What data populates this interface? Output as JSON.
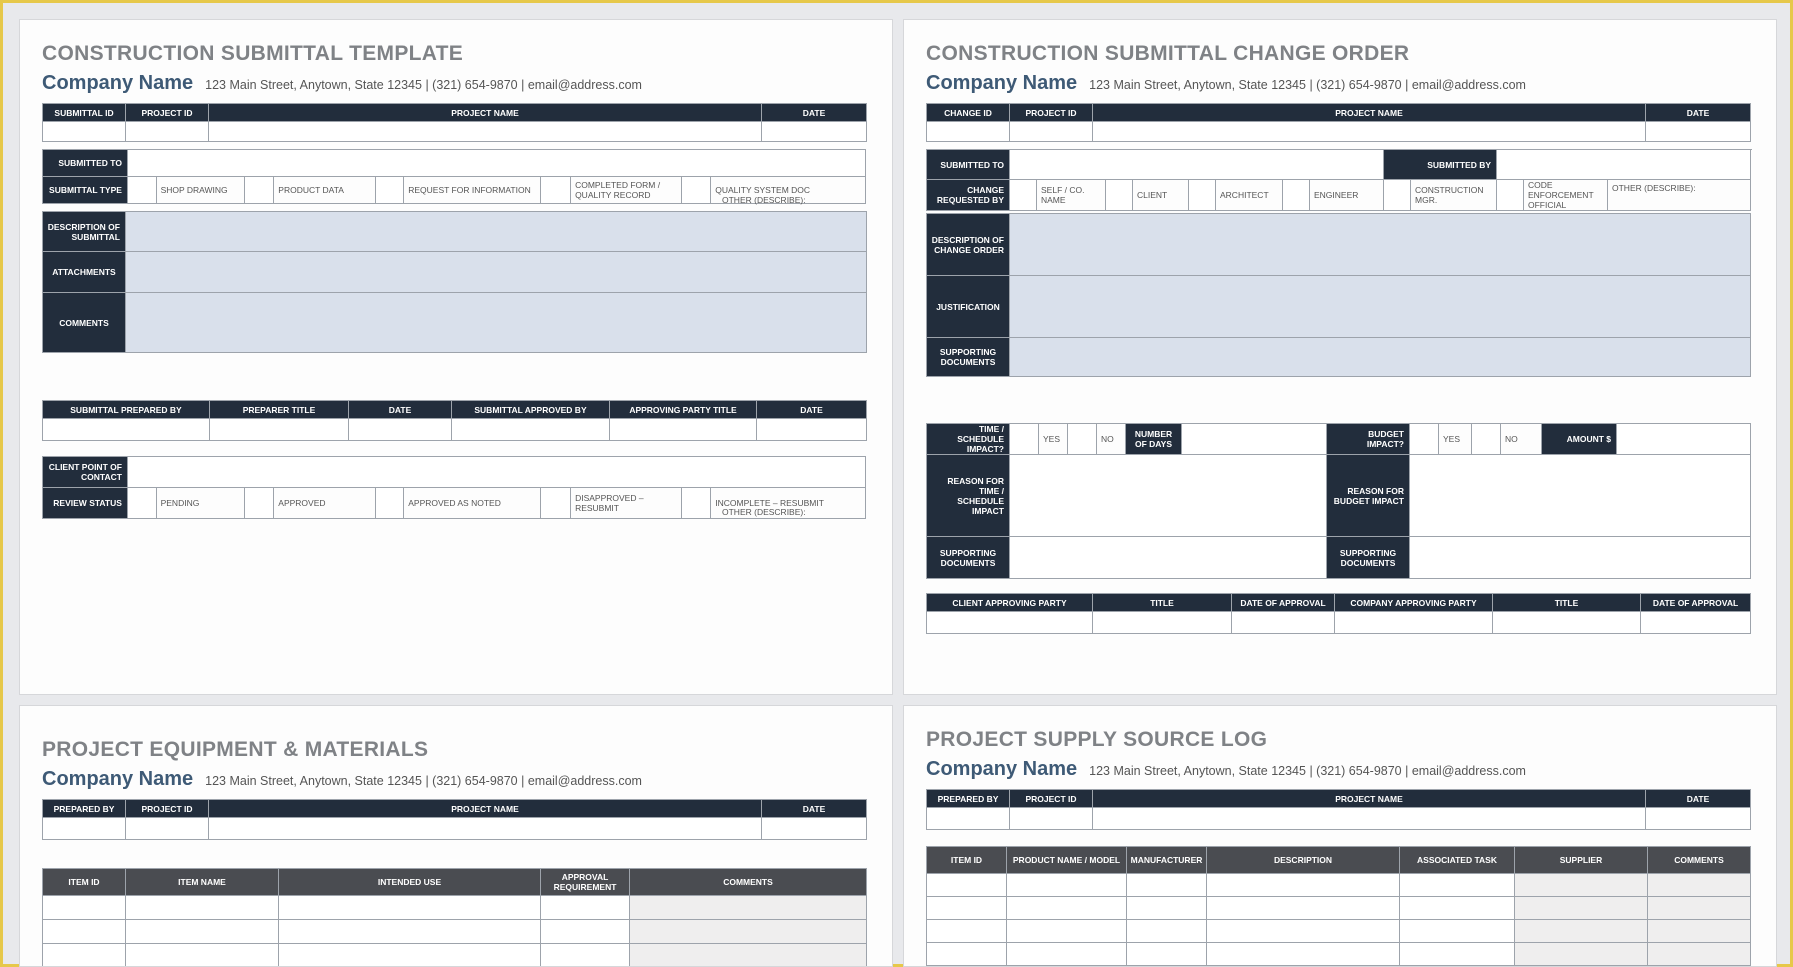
{
  "company": {
    "name": "Company Name",
    "address": "123 Main Street, Anytown, State 12345  |  (321) 654-9870  |  email@address.com"
  },
  "submittal": {
    "title": "CONSTRUCTION SUBMITTAL TEMPLATE",
    "header": [
      "SUBMITTAL ID",
      "PROJECT ID",
      "PROJECT NAME",
      "DATE"
    ],
    "submitted_to": "SUBMITTED TO",
    "submittal_type": "SUBMITTAL TYPE",
    "type_options": [
      "SHOP DRAWING",
      "PRODUCT DATA",
      "REQUEST FOR INFORMATION",
      "COMPLETED FORM / QUALITY RECORD",
      "QUALITY SYSTEM DOC",
      "OTHER (DESCRIBE):"
    ],
    "description": "DESCRIPTION OF SUBMITTAL",
    "attachments": "ATTACHMENTS",
    "comments": "COMMENTS",
    "approval_header": [
      "SUBMITTAL PREPARED BY",
      "PREPARER TITLE",
      "DATE",
      "SUBMITTAL APPROVED BY",
      "APPROVING PARTY TITLE",
      "DATE"
    ],
    "client_poc": "CLIENT POINT OF CONTACT",
    "review_status": "REVIEW STATUS",
    "status_options": [
      "PENDING",
      "APPROVED",
      "APPROVED AS NOTED",
      "DISAPPROVED – RESUBMIT",
      "INCOMPLETE – RESUBMIT",
      "OTHER (DESCRIBE):"
    ]
  },
  "change_order": {
    "title": "CONSTRUCTION SUBMITTAL CHANGE ORDER",
    "header": [
      "CHANGE ID",
      "PROJECT ID",
      "PROJECT NAME",
      "DATE"
    ],
    "submitted_to": "SUBMITTED TO",
    "submitted_by": "SUBMITTED BY",
    "change_requested_by": "CHANGE REQUESTED BY",
    "requester_options": [
      "SELF / CO. NAME",
      "CLIENT",
      "ARCHITECT",
      "ENGINEER",
      "CONSTRUCTION MGR.",
      "CODE ENFORCEMENT OFFICIAL",
      "OTHER (DESCRIBE):"
    ],
    "description": "DESCRIPTION OF CHANGE ORDER",
    "justification": "JUSTIFICATION",
    "supporting_documents": "SUPPORTING DOCUMENTS",
    "time_impact": "TIME / SCHEDULE IMPACT?",
    "yes": "YES",
    "no": "NO",
    "number_of_days": "NUMBER OF DAYS",
    "budget_impact": "BUDGET IMPACT?",
    "amount": "AMOUNT $",
    "reason_time": "REASON FOR TIME / SCHEDULE IMPACT",
    "reason_budget": "REASON FOR BUDGET IMPACT",
    "approval_header": [
      "CLIENT APPROVING PARTY",
      "TITLE",
      "DATE OF APPROVAL",
      "COMPANY APPROVING PARTY",
      "TITLE",
      "DATE OF APPROVAL"
    ]
  },
  "equipment": {
    "title": "PROJECT EQUIPMENT & MATERIALS",
    "header": [
      "PREPARED BY",
      "PROJECT ID",
      "PROJECT NAME",
      "DATE"
    ],
    "columns": [
      "ITEM ID",
      "ITEM NAME",
      "INTENDED USE",
      "APPROVAL REQUIREMENT",
      "COMMENTS"
    ]
  },
  "supply": {
    "title": "PROJECT SUPPLY SOURCE LOG",
    "header": [
      "PREPARED BY",
      "PROJECT ID",
      "PROJECT NAME",
      "DATE"
    ],
    "columns": [
      "ITEM ID",
      "PRODUCT NAME / MODEL",
      "MANUFACTURER",
      "DESCRIPTION",
      "ASSOCIATED TASK",
      "SUPPLIER",
      "COMMENTS"
    ]
  },
  "colors": {
    "header_navy": "#222d3c",
    "header_gray": "#4a4c51",
    "fill_blue": "#d9e0eb",
    "title_gray": "#7f8286",
    "company_blue": "#3e5a76"
  }
}
